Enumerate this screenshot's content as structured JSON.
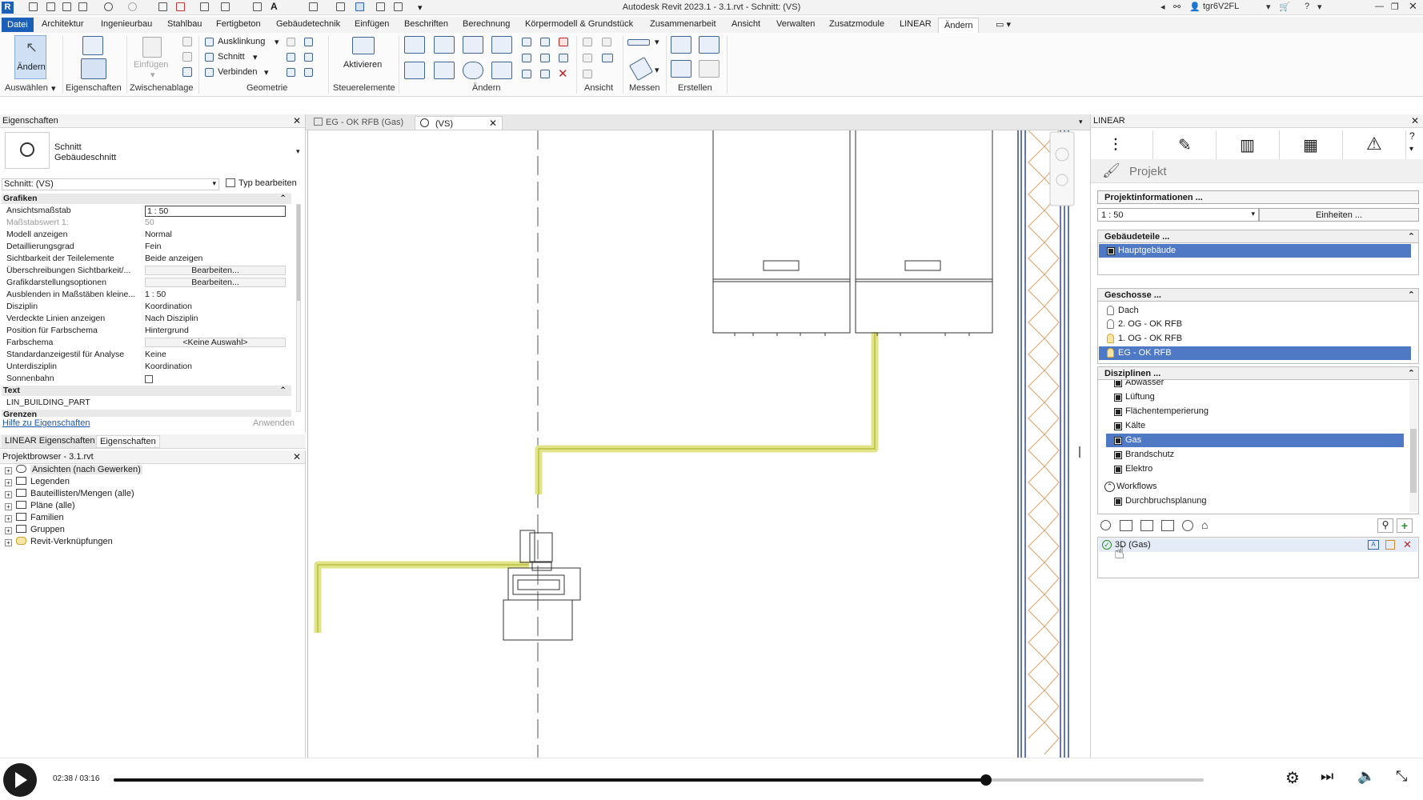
{
  "window": {
    "title": "Autodesk Revit 2023.1 - 3.1.rvt - Schnitt: (VS)",
    "user": "tgr6V2FL",
    "app_badge": "R"
  },
  "menu": {
    "items": [
      "Datei",
      "Architektur",
      "Ingenieurbau",
      "Stahlbau",
      "Fertigbeton",
      "Gebäudetechnik",
      "Einfügen",
      "Beschriften",
      "Berechnung",
      "Körpermodell & Grundstück",
      "Zusammenarbeit",
      "Ansicht",
      "Verwalten",
      "Zusatzmodule",
      "LINEAR",
      "Ändern"
    ]
  },
  "ribbon": {
    "aendern_btn": "Ändern",
    "eigenschaften_btn": "",
    "einfuegen_btn": "Einfügen",
    "ausklinkung": "Ausklinkung",
    "schnitt": "Schnitt",
    "verbinden": "Verbinden",
    "aktivieren": "Aktivieren",
    "groups": {
      "auswaehlen": "Auswählen",
      "eigenschaften": "Eigenschaften",
      "zwischenablage": "Zwischenablage",
      "geometrie": "Geometrie",
      "steuerelemente": "Steuerelemente",
      "aendern": "Ändern",
      "ansicht": "Ansicht",
      "messen": "Messen",
      "erstellen": "Erstellen"
    }
  },
  "properties": {
    "title": "Eigenschaften",
    "type_line1": "Schnitt",
    "type_line2": "Gebäudeschnitt",
    "instance_select": "Schnitt: (VS)",
    "typ_bearbeiten": "Typ bearbeiten",
    "section_grafiken": "Grafiken",
    "rows": [
      {
        "k": "Ansichtsmaßstab",
        "v": "1 : 50"
      },
      {
        "k": "Maßstabswert 1:",
        "v": "50"
      },
      {
        "k": "Modell anzeigen",
        "v": "Normal"
      },
      {
        "k": "Detaillierungsgrad",
        "v": "Fein"
      },
      {
        "k": "Sichtbarkeit der Teilelemente",
        "v": "Beide anzeigen"
      },
      {
        "k": "Überschreibungen Sichtbarkeit/...",
        "v": "Bearbeiten..."
      },
      {
        "k": "Grafikdarstellungsoptionen",
        "v": "Bearbeiten..."
      },
      {
        "k": "Ausblenden in Maßstäben kleine...",
        "v": "1 : 50"
      },
      {
        "k": "Disziplin",
        "v": "Koordination"
      },
      {
        "k": "Verdeckte Linien anzeigen",
        "v": "Nach Disziplin"
      },
      {
        "k": "Position für Farbschema",
        "v": "Hintergrund"
      },
      {
        "k": "Farbschema",
        "v": "<Keine Auswahl>"
      },
      {
        "k": "Standardanzeigestil für Analyse",
        "v": "Keine"
      },
      {
        "k": "Unterdisziplin",
        "v": "Koordination"
      },
      {
        "k": "Sonnenbahn",
        "v": ""
      }
    ],
    "section_text": "Text",
    "text_row": "LIN_BUILDING_PART",
    "section_grenzen": "Grenzen",
    "help_link": "Hilfe zu Eigenschaften",
    "apply_btn": "Anwenden",
    "tab1": "LINEAR Eigenschaften",
    "tab2": "Eigenschaften"
  },
  "browser": {
    "title": "Projektbrowser - 3.1.rvt",
    "items": [
      "Ansichten (nach Gewerken)",
      "Legenden",
      "Bauteillisten/Mengen (alle)",
      "Pläne (alle)",
      "Familien",
      "Gruppen",
      "Revit-Verknüpfungen"
    ]
  },
  "viewtabs": {
    "tab1": "EG - OK RFB (Gas)",
    "tab2": "(VS)"
  },
  "linear": {
    "title": "LINEAR",
    "projekt": "Projekt",
    "projektinfo": "Projektinformationen ...",
    "scale": "1 : 50",
    "einheiten": "Einheiten ...",
    "gebaeudeteile_head": "Gebäudeteile ...",
    "gebaeudeteile": [
      "Hauptgebäude"
    ],
    "geschosse_head": "Geschosse ...",
    "geschosse": [
      "Dach",
      "2. OG - OK RFB",
      "1. OG - OK RFB",
      "EG - OK RFB"
    ],
    "disziplinen_head": "Disziplinen ...",
    "disziplinen": [
      "Abwasser",
      "Lüftung",
      "Flächentemperierung",
      "Kälte",
      "Gas",
      "Brandschutz",
      "Elektro"
    ],
    "workflows": "Workflows",
    "workflow_items": [
      "Durchbruchsplanung"
    ],
    "result_item": "3D (Gas)"
  },
  "video": {
    "time": "02:38 / 03:16",
    "progress": 0.8
  }
}
